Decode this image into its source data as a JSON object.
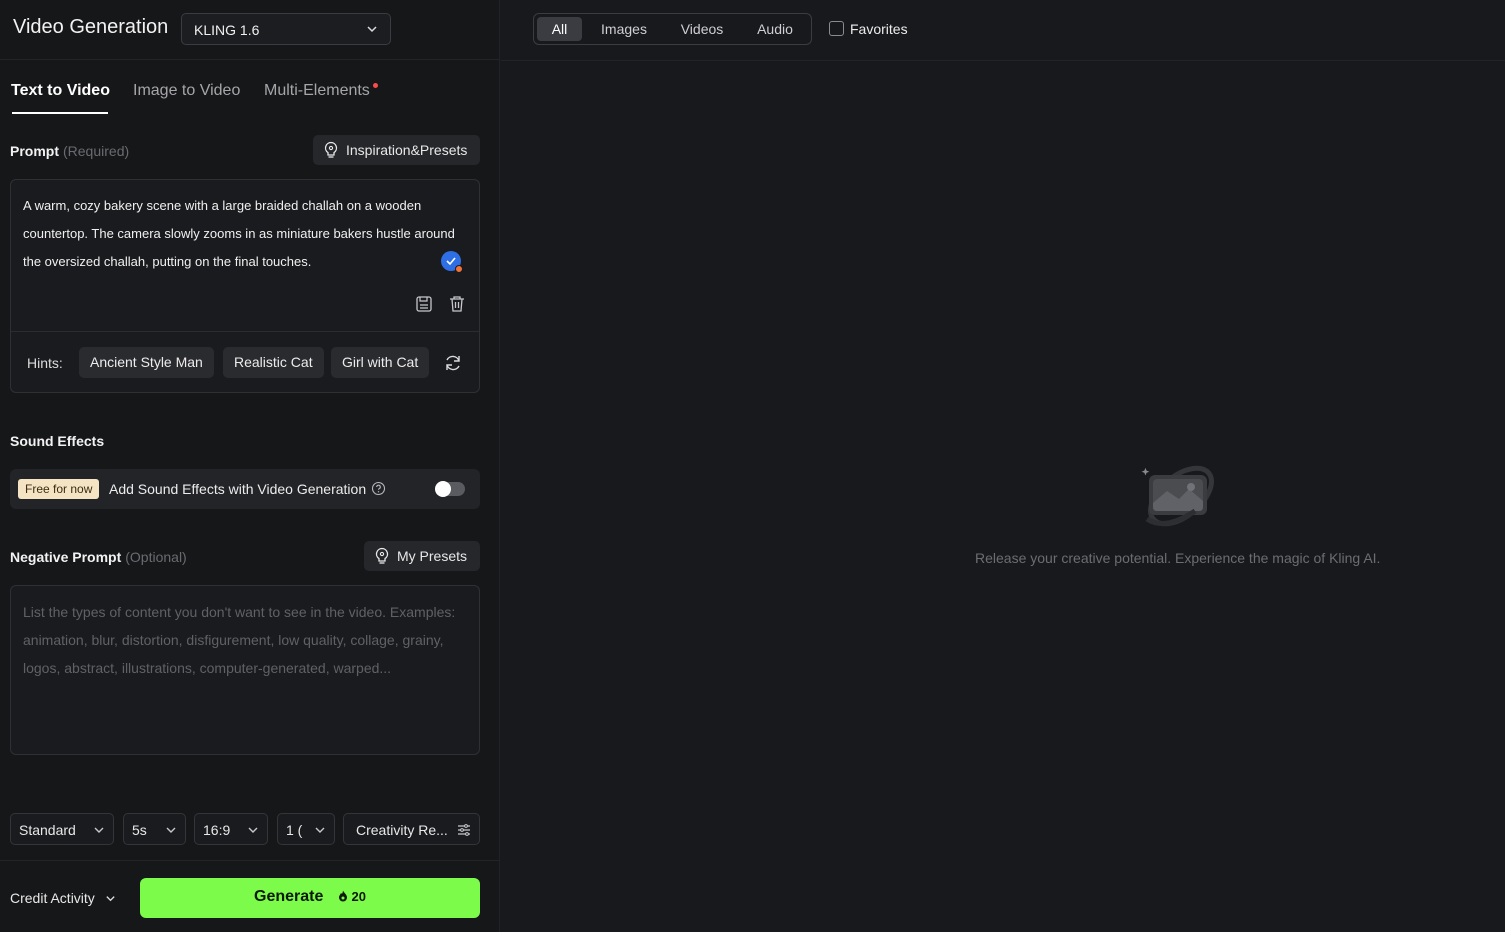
{
  "header": {
    "title": "Video Generation",
    "model": "KLING 1.6"
  },
  "tabs": [
    {
      "label": "Text to Video",
      "active": true
    },
    {
      "label": "Image to Video",
      "active": false
    },
    {
      "label": "Multi-Elements",
      "active": false,
      "notification_dot": true
    }
  ],
  "prompt": {
    "label": "Prompt",
    "required_note": "(Required)",
    "presets_button": "Inspiration&Presets",
    "text": "A warm, cozy bakery scene with a large braided challah on a wooden countertop. The camera slowly zooms in as miniature bakers hustle around the oversized challah, putting on the final touches.",
    "hints_label": "Hints:",
    "hints": [
      "Ancient Style Man",
      "Realistic Cat",
      "Girl with Cat"
    ]
  },
  "sound_effects": {
    "title": "Sound Effects",
    "badge": "Free for now",
    "label": "Add Sound Effects with Video Generation",
    "enabled": false
  },
  "negative_prompt": {
    "label": "Negative Prompt",
    "optional_note": "(Optional)",
    "presets_button": "My Presets",
    "placeholder": "List the types of content you don't want to see in the video. Examples: animation, blur, distortion, disfigurement, low quality, collage, grainy, logos, abstract, illustrations, computer-generated, warped..."
  },
  "options": {
    "mode": "Standard",
    "duration": "5s",
    "aspect_ratio": "16:9",
    "count": "1 (",
    "creativity": "Creativity Re..."
  },
  "footer": {
    "credit_label": "Credit Activity",
    "generate_label": "Generate",
    "cost": "20"
  },
  "library": {
    "filters": [
      {
        "label": "All",
        "active": true
      },
      {
        "label": "Images",
        "active": false
      },
      {
        "label": "Videos",
        "active": false
      },
      {
        "label": "Audio",
        "active": false
      }
    ],
    "favorites_label": "Favorites",
    "favorites_checked": false,
    "empty_message": "Release your creative potential. Experience the magic of Kling AI."
  },
  "colors": {
    "accent_green": "#7dfb4b",
    "background": "#18191c",
    "notification": "#ff4a4a"
  }
}
